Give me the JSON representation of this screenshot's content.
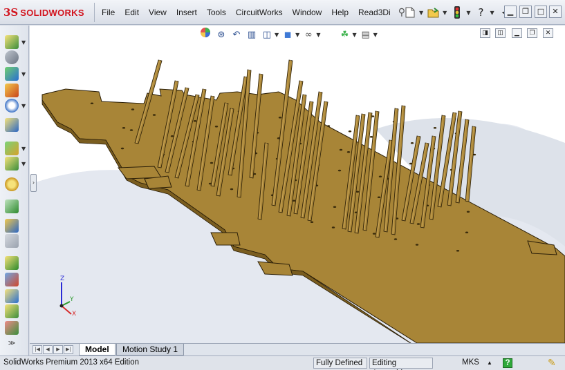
{
  "app": {
    "logo_mark": "3S",
    "logo_text": "SOLIDWORKS"
  },
  "menu": {
    "items": [
      "File",
      "Edit",
      "View",
      "Insert",
      "Tools",
      "CircuitWorks",
      "Window",
      "Help",
      "Read3Di"
    ]
  },
  "toolbar": {
    "icons": [
      "new-document-icon",
      "open-folder-icon",
      "traffic-light-icon",
      "help-icon",
      "arrow-icon"
    ]
  },
  "window_controls": [
    "minimize",
    "restore",
    "close"
  ],
  "heads_up_view": {
    "icons": [
      "zoom-to-fit-icon",
      "zoom-to-area-icon",
      "previous-view-icon",
      "section-view-icon",
      "view-orientation-icon",
      "display-style-icon",
      "hide-show-items-icon",
      "edit-appearance-icon",
      "apply-scene-icon",
      "view-settings-icon"
    ]
  },
  "triad": {
    "x": "X",
    "y": "Y",
    "z": "Z"
  },
  "tabs": {
    "items": [
      "Model",
      "Motion Study 1"
    ],
    "active": "Model"
  },
  "status": {
    "product": "SolidWorks Premium 2013 x64 Edition",
    "definition": "Fully Defined",
    "mode": "Editing Assembly",
    "units": "MKS"
  },
  "colors": {
    "part_face": "#a88537",
    "part_edge": "#2a1e08",
    "accent_red": "#d2141e"
  }
}
